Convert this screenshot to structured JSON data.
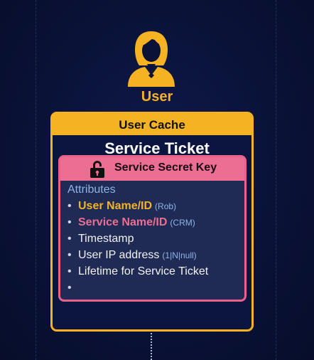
{
  "user": {
    "label": "User",
    "icon": "user-female-icon",
    "color": "#f5b223"
  },
  "cache": {
    "title": "User Cache",
    "color": "#f5b223"
  },
  "ticket": {
    "title": "Service Ticket",
    "header": "Service Secret Key",
    "header_icon": "lock-icon",
    "color": "#ec6f93"
  },
  "attributes": {
    "title": "Attributes",
    "items": [
      {
        "text": "User Name/ID",
        "note": "(Rob)"
      },
      {
        "text": "Service Name/ID",
        "note": "(CRM)"
      },
      {
        "text": "Timestamp",
        "note": ""
      },
      {
        "text": "User IP address",
        "note": "(1|N|null)"
      },
      {
        "text": "Lifetime for Service Ticket",
        "note": ""
      },
      {
        "text": "",
        "note": ""
      }
    ],
    "bullet": "•"
  }
}
